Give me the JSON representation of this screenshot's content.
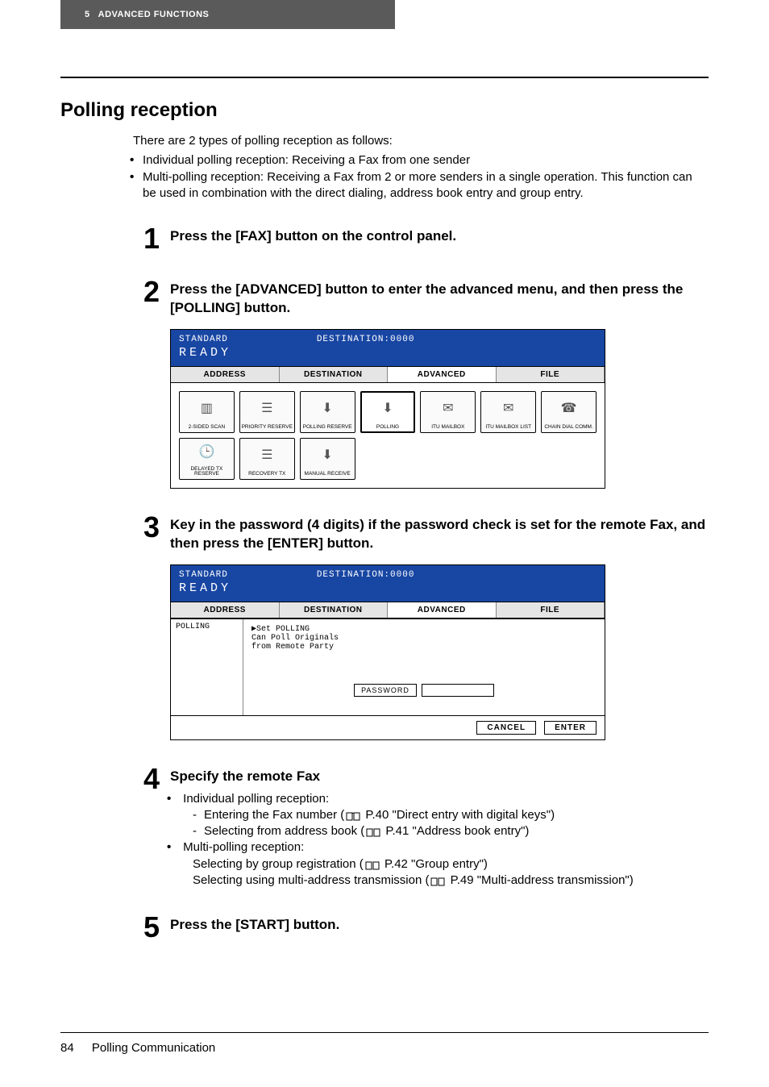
{
  "header": {
    "chapter_num": "5",
    "chapter_title": "ADVANCED FUNCTIONS"
  },
  "section_title": "Polling reception",
  "intro": {
    "lead": "There are 2 types of polling reception as follows:",
    "bullets": [
      "Individual polling reception: Receiving a Fax from one sender",
      "Multi-polling reception: Receiving a Fax from 2 or more senders in a single operation. This function can be used in combination with the direct dialing, address book entry and group entry."
    ]
  },
  "steps": [
    {
      "num": "1",
      "title": "Press the [FAX] button on the control panel."
    },
    {
      "num": "2",
      "title": "Press the [ADVANCED] button to enter the advanced menu, and then press the [POLLING] button."
    },
    {
      "num": "3",
      "title": "Key in the password (4 digits) if the password check is set for the remote Fax, and then press the [ENTER] button."
    },
    {
      "num": "4",
      "title": "Specify the remote Fax"
    },
    {
      "num": "5",
      "title": "Press the [START] button."
    }
  ],
  "step4_text": {
    "bullets": [
      {
        "text": "Individual polling reception:",
        "subs": [
          {
            "label": "Entering the Fax number (",
            "ref": " P.40 \"Direct entry with digital keys\")"
          },
          {
            "label": "Selecting from address book (",
            "ref": " P.41 \"Address book entry\")"
          }
        ]
      },
      {
        "text": "Multi-polling reception:",
        "lines": [
          {
            "label": "Selecting by group registration (",
            "ref": " P.42 \"Group entry\")"
          },
          {
            "label": "Selecting using multi-address transmission (",
            "ref": " P.49 \"Multi-address transmission\")"
          }
        ]
      }
    ]
  },
  "ui_shot1": {
    "banner_left": "STANDARD",
    "banner_right": "DESTINATION:0000",
    "ready": "READY",
    "tabs": [
      "ADDRESS",
      "DESTINATION",
      "ADVANCED",
      "FILE"
    ],
    "active_tab": 2,
    "row1": [
      "2-SIDED SCAN",
      "PRIORITY RESERVE",
      "POLLING RESERVE",
      "POLLING",
      "ITU MAILBOX",
      "ITU MAILBOX LIST",
      "CHAIN DIAL COMM."
    ],
    "row2": [
      "DELAYED TX RESERVE",
      "RECOVERY TX",
      "MANUAL RECEIVE"
    ],
    "selected": "POLLING"
  },
  "ui_shot2": {
    "banner_left": "STANDARD",
    "banner_right": "DESTINATION:0000",
    "ready": "READY",
    "tabs": [
      "ADDRESS",
      "DESTINATION",
      "ADVANCED",
      "FILE"
    ],
    "active_tab": 2,
    "left_label": "POLLING",
    "right_lines": [
      "▶Set POLLING",
      " Can Poll Originals",
      " from Remote Party"
    ],
    "password_label": "PASSWORD",
    "cancel": "CANCEL",
    "enter": "ENTER"
  },
  "footer": {
    "page": "84",
    "title": "Polling Communication"
  }
}
